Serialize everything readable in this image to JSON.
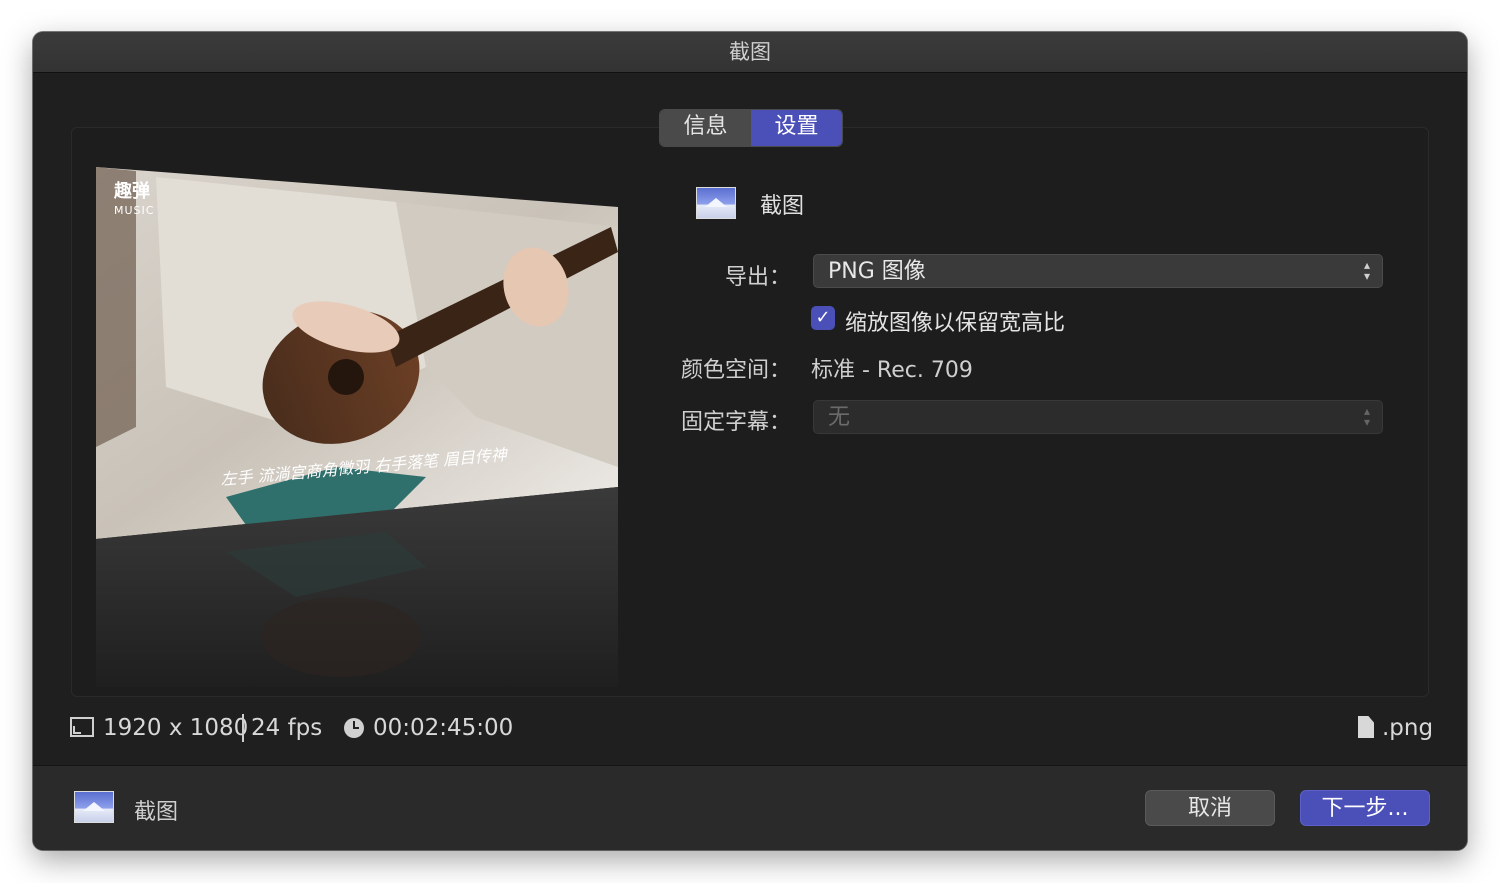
{
  "window": {
    "title": "截图"
  },
  "tabs": [
    {
      "label": "信息",
      "active": false
    },
    {
      "label": "设置",
      "active": true
    }
  ],
  "preview": {
    "watermark_title": "趣弹",
    "watermark_sub": "MUSIC",
    "subtitle_text": "左手 流淌宫商角徵羽 右手落笔 眉目传神"
  },
  "settings": {
    "preset_name": "截图",
    "export_label": "导出：",
    "export_value": "PNG 图像",
    "scale_checkbox_label": "缩放图像以保留宽高比",
    "scale_checked": true,
    "color_space_label": "颜色空间：",
    "color_space_value": "标准 - Rec. 709",
    "burn_in_label": "固定字幕：",
    "burn_in_value": "无"
  },
  "info": {
    "resolution": "1920 x 1080",
    "fps": "24 fps",
    "duration": "00:02:45:00",
    "extension": ".png"
  },
  "footer": {
    "preset_name": "截图",
    "cancel_label": "取消",
    "next_label": "下一步..."
  },
  "colors": {
    "accent": "#4b4fb8",
    "window_bg": "#1f1f1f",
    "titlebar_bg": "#353535",
    "footer_bg": "#2a2a2a"
  }
}
